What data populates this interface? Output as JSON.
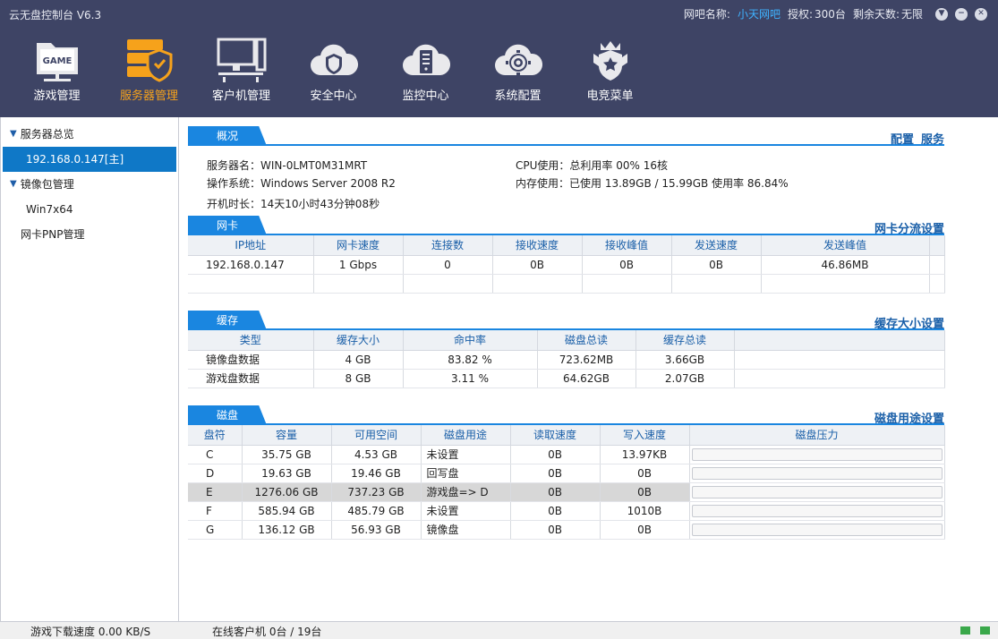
{
  "app": {
    "title": "云无盘控制台 V6.3",
    "cafe_label": "网吧名称:",
    "cafe_name": "小天网吧",
    "license_label": "授权:",
    "license_value": "300台",
    "days_label": "剩余天数:",
    "days_value": "无限"
  },
  "nav": [
    {
      "label": "游戏管理",
      "icon": "game-folder-icon"
    },
    {
      "label": "服务器管理",
      "icon": "server-shield-icon",
      "active": true
    },
    {
      "label": "客户机管理",
      "icon": "client-computers-icon"
    },
    {
      "label": "安全中心",
      "icon": "security-cloud-icon"
    },
    {
      "label": "监控中心",
      "icon": "monitor-cloud-icon"
    },
    {
      "label": "系统配置",
      "icon": "settings-cloud-icon"
    },
    {
      "label": "电竞菜单",
      "icon": "esports-badge-icon"
    }
  ],
  "sidebar": {
    "overview": "服务器总览",
    "server": "192.168.0.147[主]",
    "image_mgmt": "镜像包管理",
    "image_item": "Win7x64",
    "pnp": "网卡PNP管理"
  },
  "overview": {
    "tab": "概况",
    "link_config": "配置",
    "link_service": "服务",
    "server_name": "服务器名：WIN-0LMT0M31MRT",
    "os": "操作系统：Windows Server 2008 R2",
    "uptime": "开机时长：14天10小时43分钟08秒",
    "cpu": "CPU使用：总利用率 00% 16核",
    "mem": "内存使用：已使用 13.89GB / 15.99GB 使用率 86.84%"
  },
  "nic": {
    "tab": "网卡",
    "link": "网卡分流设置",
    "headers": [
      "IP地址",
      "网卡速度",
      "连接数",
      "接收速度",
      "接收峰值",
      "发送速度",
      "发送峰值"
    ],
    "rows": [
      [
        "192.168.0.147",
        "1 Gbps",
        "0",
        "0B",
        "0B",
        "0B",
        "46.86MB"
      ]
    ]
  },
  "cache": {
    "tab": "缓存",
    "link": "缓存大小设置",
    "headers": [
      "类型",
      "缓存大小",
      "命中率",
      "磁盘总读",
      "缓存总读"
    ],
    "rows": [
      [
        "镜像盘数据",
        "4 GB",
        "83.82 %",
        "723.62MB",
        "3.66GB"
      ],
      [
        "游戏盘数据",
        "8 GB",
        "3.11 %",
        "64.62GB",
        "2.07GB"
      ]
    ]
  },
  "disk": {
    "tab": "磁盘",
    "link": "磁盘用途设置",
    "headers": [
      "盘符",
      "容量",
      "可用空间",
      "磁盘用途",
      "读取速度",
      "写入速度",
      "磁盘压力"
    ],
    "rows": [
      [
        "C",
        "35.75 GB",
        "4.53 GB",
        "未设置",
        "0B",
        "13.97KB"
      ],
      [
        "D",
        "19.63 GB",
        "19.46 GB",
        "回写盘",
        "0B",
        "0B"
      ],
      [
        "E",
        "1276.06 GB",
        "737.23 GB",
        "游戏盘=> D",
        "0B",
        "0B"
      ],
      [
        "F",
        "585.94 GB",
        "485.79 GB",
        "未设置",
        "0B",
        "1010B"
      ],
      [
        "G",
        "136.12 GB",
        "56.93 GB",
        "镜像盘",
        "0B",
        "0B"
      ]
    ],
    "highlight_row": 2
  },
  "footer": {
    "download": "游戏下载速度 0.00 KB/S",
    "online": "在线客户机  0台 / 19台"
  },
  "colors": {
    "header_bg": "#3e4465",
    "accent": "#1a86e0",
    "active_nav": "#f6a21b",
    "status_led": "#3aa84a"
  }
}
